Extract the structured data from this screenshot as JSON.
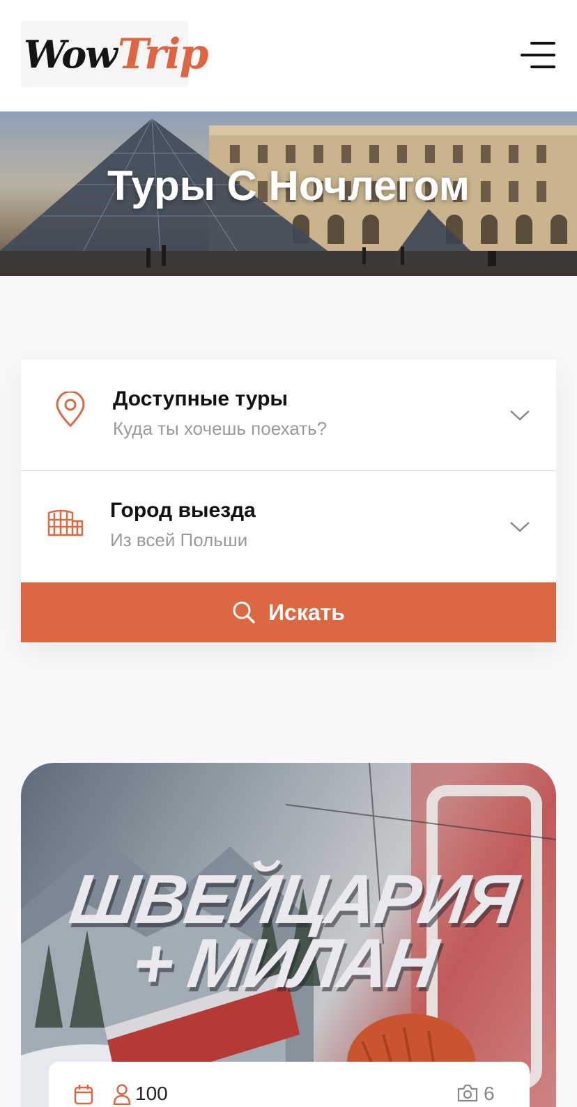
{
  "header": {
    "logo_part1": "Wow",
    "logo_part2": "Trip",
    "menu_icon": "hamburger-menu-icon"
  },
  "hero": {
    "title": "Туры С Ночлегом"
  },
  "search": {
    "tours": {
      "label": "Доступные туры",
      "value": "Куда ты хочешь поехать?",
      "icon": "location-pin-icon"
    },
    "departure": {
      "label": "Город выезда",
      "value": "Из всей Польши",
      "icon": "city-building-icon"
    },
    "button_label": "Искать",
    "button_icon": "search-icon"
  },
  "tour_card": {
    "image_title_line1": "ШВЕЙЦАРИЯ",
    "image_title_line2": "+ МИЛАН",
    "participants": "100",
    "photos": "6"
  },
  "colors": {
    "accent": "#dc6842",
    "text": "#111111",
    "muted": "#9a9a9a"
  }
}
